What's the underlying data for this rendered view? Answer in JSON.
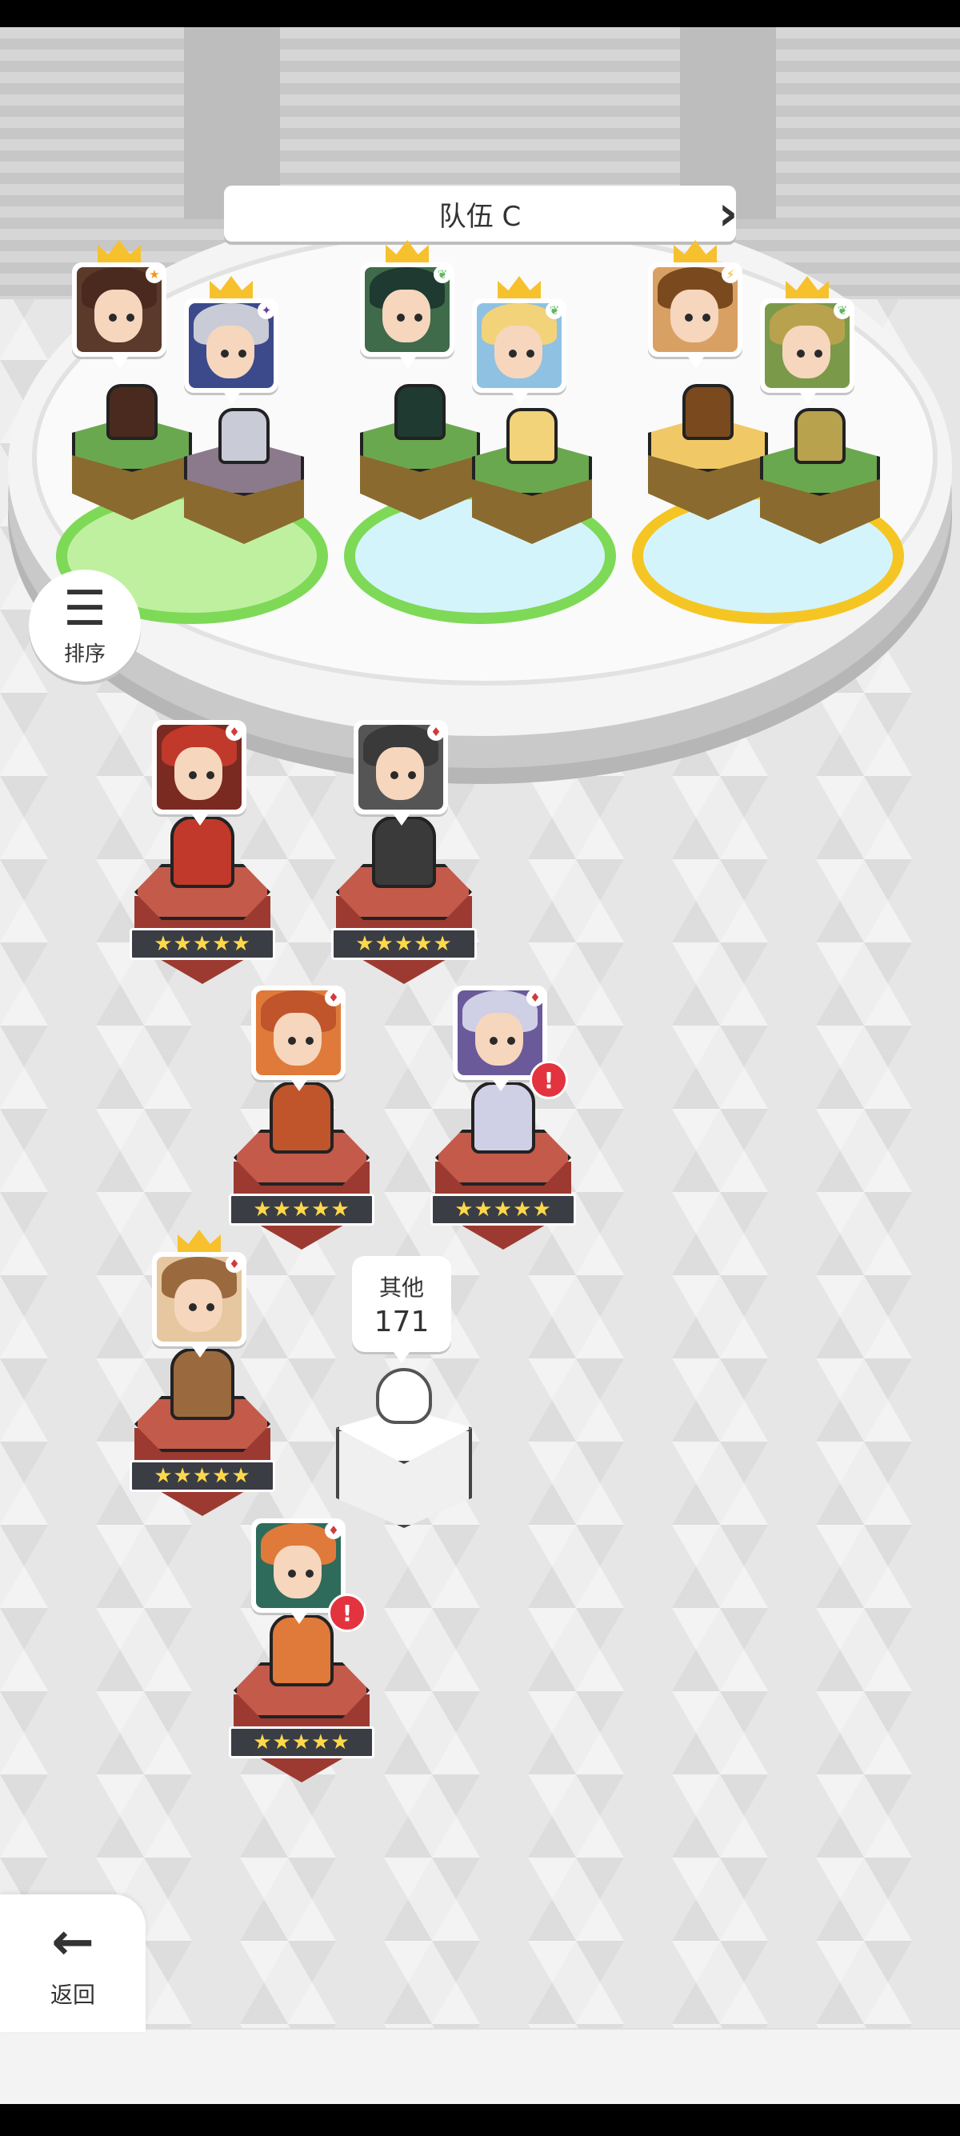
{
  "header": {
    "team_name": "队伍 C",
    "prev_icon": "chevron-left-icon",
    "next_icon": "chevron-right-icon"
  },
  "sort_button": {
    "icon": "sort-icon",
    "label": "排序"
  },
  "back_button": {
    "icon": "arrow-left-icon",
    "label": "返回"
  },
  "team_slots": [
    {
      "ring_color": "#7ed957",
      "members": [
        {
          "hair": "#4a2a1e",
          "bg": "#5b3a2c",
          "badge": "★",
          "badge_color": "#f7941d",
          "crowned": true,
          "block": "#6aa84f"
        },
        {
          "hair": "#c9ccd6",
          "bg": "#3c4a8c",
          "badge": "✦",
          "badge_color": "#6a3fa0",
          "crowned": true,
          "block": "#8b7a8c"
        }
      ]
    },
    {
      "ring_color": "#7ed957",
      "members": [
        {
          "hair": "#1f3a30",
          "bg": "#3f6b4a",
          "badge": "❦",
          "badge_color": "#5cb85c",
          "crowned": true,
          "block": "#6aa84f"
        },
        {
          "hair": "#f2d37a",
          "bg": "#8fc1e3",
          "badge": "❦",
          "badge_color": "#5cb85c",
          "crowned": true,
          "block": "#6aa84f"
        }
      ]
    },
    {
      "ring_color": "#f5c623",
      "members": [
        {
          "hair": "#7a4a1e",
          "bg": "#d9a064",
          "badge": "⚡",
          "badge_color": "#f5b700",
          "crowned": true,
          "block": "#f0c866"
        },
        {
          "hair": "#b8a24e",
          "bg": "#7a9a4a",
          "badge": "❦",
          "badge_color": "#5cb85c",
          "crowned": true,
          "block": "#6aa84f"
        }
      ]
    }
  ],
  "roster": [
    {
      "hair": "#c0392b",
      "bg": "#7a2a20",
      "badge": "♦",
      "crowned": false,
      "alert": false,
      "stars": "★★★★★"
    },
    {
      "hair": "#3a3a3a",
      "bg": "#555555",
      "badge": "♦",
      "crowned": false,
      "alert": false,
      "stars": "★★★★★"
    },
    {
      "hair": "#c0552b",
      "bg": "#e07a3a",
      "badge": "♦",
      "crowned": false,
      "alert": false,
      "stars": "★★★★★"
    },
    {
      "hair": "#cfcfe6",
      "bg": "#6a5a9a",
      "badge": "♦",
      "crowned": false,
      "alert": true,
      "stars": "★★★★★"
    },
    {
      "hair": "#9a6a3e",
      "bg": "#e6c7a0",
      "badge": "♦",
      "crowned": true,
      "alert": false,
      "stars": "★★★★★"
    },
    {
      "hair": "#e07a3a",
      "bg": "#2f6b5a",
      "badge": "♦",
      "crowned": false,
      "alert": true,
      "stars": "★★★★★"
    }
  ],
  "others": {
    "label": "其他",
    "count": "171"
  }
}
